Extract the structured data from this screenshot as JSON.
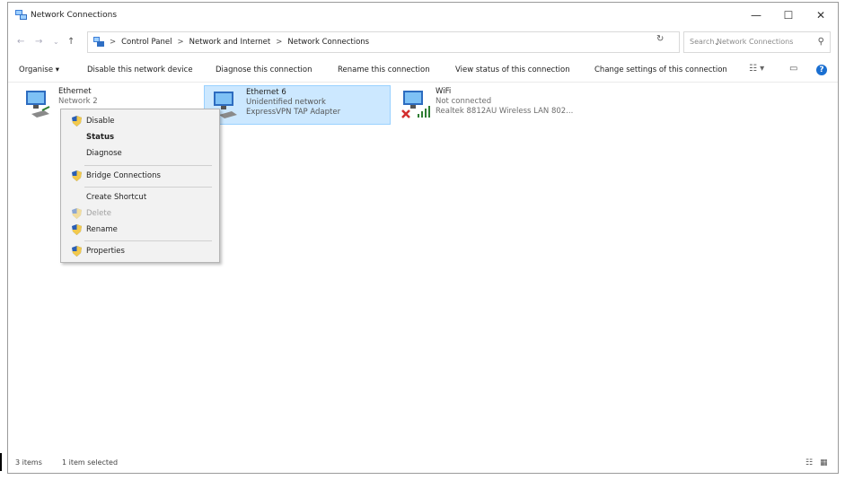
{
  "window": {
    "title": "Network Connections",
    "controls": {
      "minimize": "—",
      "maximize": "☐",
      "close": "✕"
    }
  },
  "address": {
    "breadcrumbs": [
      "Control Panel",
      "Network and Internet",
      "Network Connections"
    ],
    "separator": ">",
    "search_placeholder": "Search Network Connections"
  },
  "commands": {
    "organise": "Organise ▾",
    "disable": "Disable this network device",
    "diagnose": "Diagnose this connection",
    "rename": "Rename this connection",
    "view_status": "View status of this connection",
    "change_settings": "Change settings of this connection"
  },
  "items": [
    {
      "name": "Ethernet",
      "status": "Network 2",
      "device": ""
    },
    {
      "name": "Ethernet 6",
      "status": "Unidentified network",
      "device": "ExpressVPN TAP Adapter"
    },
    {
      "name": "WiFi",
      "status": "Not connected",
      "device": "Realtek 8812AU Wireless LAN 802..."
    }
  ],
  "context_menu": {
    "disable": "Disable",
    "status": "Status",
    "diagnose": "Diagnose",
    "bridge": "Bridge Connections",
    "shortcut": "Create Shortcut",
    "delete": "Delete",
    "rename": "Rename",
    "properties": "Properties"
  },
  "status_bar": {
    "items_count": "3 items",
    "selected": "1 item selected"
  },
  "colors": {
    "selection": "#cce8ff",
    "selection_border": "#99d1ff",
    "help": "#1a6fd1"
  }
}
